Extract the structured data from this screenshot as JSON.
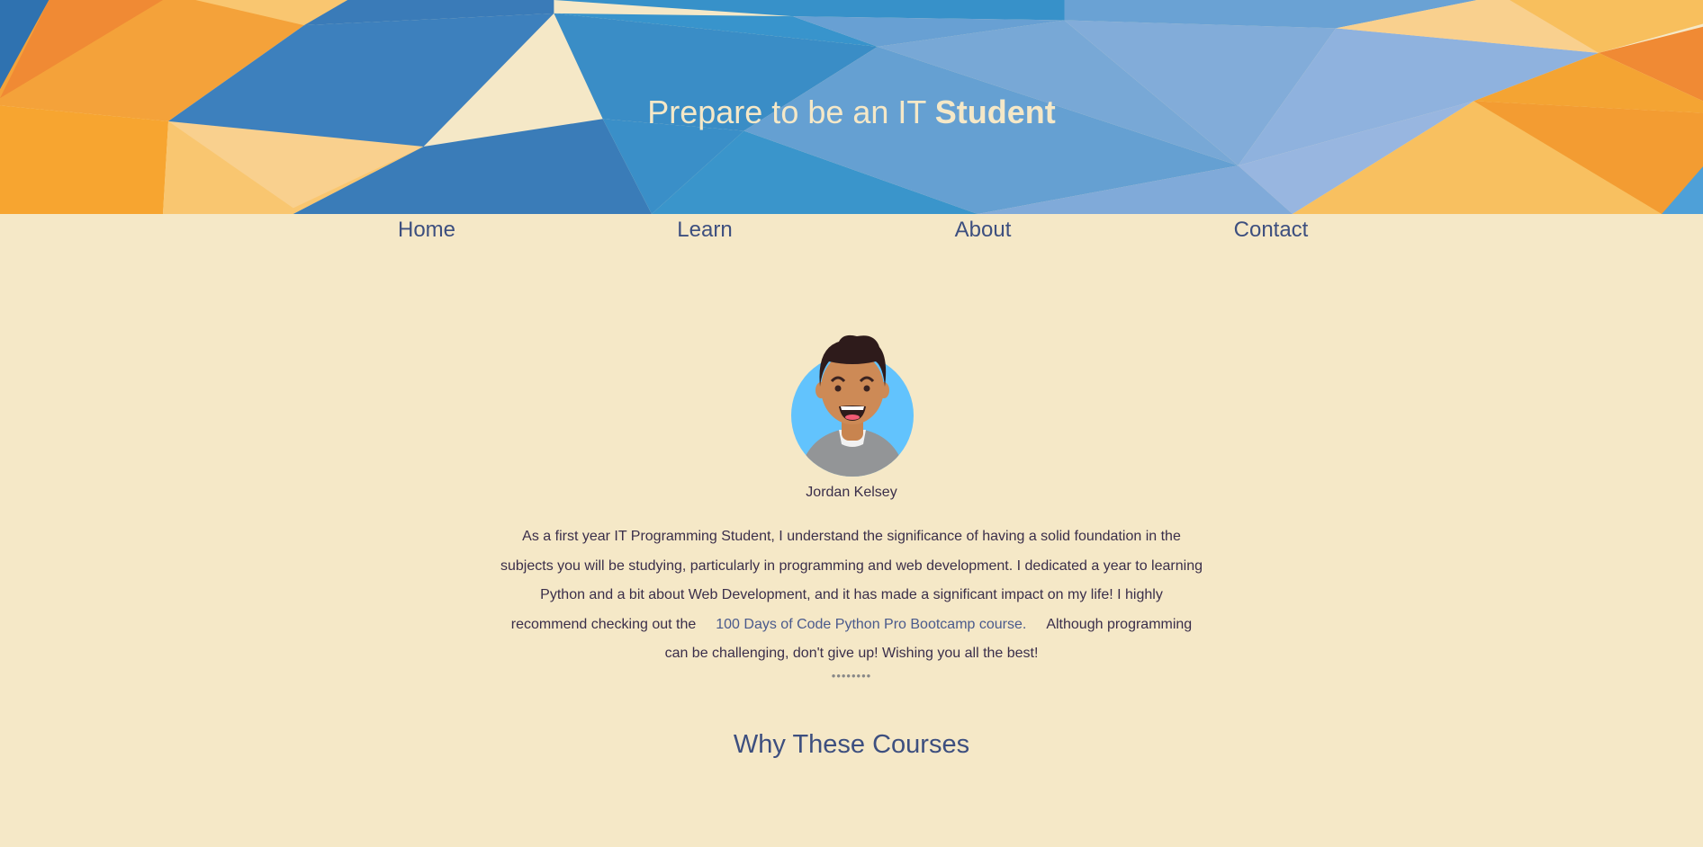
{
  "header": {
    "title_prefix": "Prepare to be an IT ",
    "title_bold": "Student"
  },
  "nav": {
    "items": [
      {
        "label": "Home"
      },
      {
        "label": "Learn"
      },
      {
        "label": "About"
      },
      {
        "label": "Contact"
      }
    ]
  },
  "profile": {
    "name": "Jordan Kelsey",
    "bio_before": "As a first year IT Programming Student, I understand the significance of having a solid foundation in the subjects you will be studying, particularly in programming and web development. I dedicated a year to learning Python and a bit about Web Development, and it has made a significant impact on my life! I highly recommend checking out the",
    "bio_link": "100 Days of Code Python Pro Bootcamp course.",
    "bio_after": "Although programming can be challenging, don't give up! Wishing you all the best!",
    "dots": "••••••••"
  },
  "section": {
    "heading": "Why These Courses"
  },
  "colors": {
    "background": "#f5e8c7",
    "nav_text": "#3d4f7f",
    "banner_blue": "#3a8dc6",
    "banner_orange": "#f4a23a"
  }
}
